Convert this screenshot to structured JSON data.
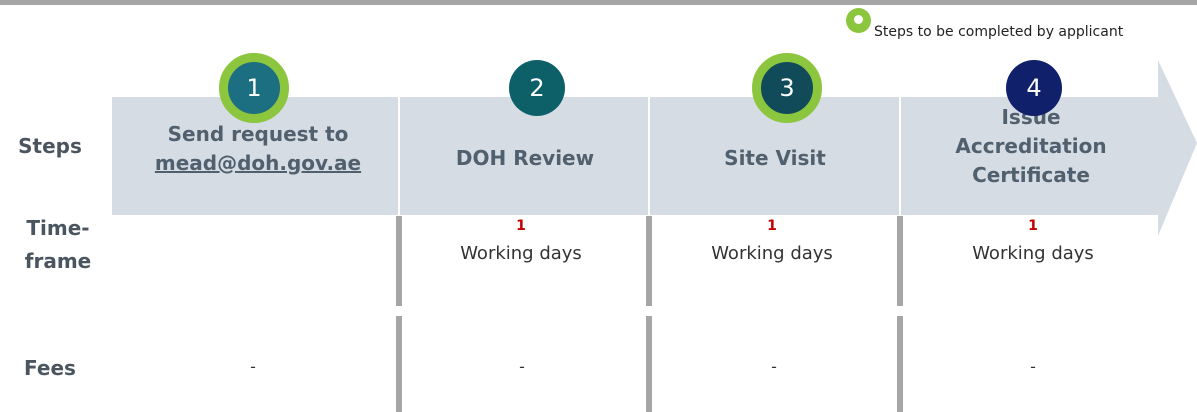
{
  "legend": {
    "text": "Steps to be completed by applicant",
    "applicant_color": "#8cc63f"
  },
  "row_labels": {
    "steps": "Steps",
    "timeframe": "Time-\nframe",
    "fees": "Fees"
  },
  "steps": [
    {
      "number": "1",
      "title_line1": "Send request to",
      "title_line2": "mead@doh.gov.ae",
      "completed_by_applicant": true,
      "badge_color": "#1b6f80"
    },
    {
      "number": "2",
      "title": "DOH Review",
      "completed_by_applicant": false,
      "badge_color": "#0e6068"
    },
    {
      "number": "3",
      "title": "Site Visit",
      "completed_by_applicant": true,
      "badge_color": "#114b5a"
    },
    {
      "number": "4",
      "title": "Issue\nAccreditation\nCertificate",
      "completed_by_applicant": false,
      "badge_color": "#10206b"
    }
  ],
  "timeframes": [
    {
      "value": "1",
      "unit": "Working days"
    },
    {
      "value": "1",
      "unit": "Working days"
    },
    {
      "value": "1",
      "unit": "Working days"
    }
  ],
  "fees": [
    "-",
    "-",
    "-",
    "-"
  ],
  "colors": {
    "arrow_fill": "#d6dce4",
    "divider": "#a6a6a6",
    "timeframe_value": "#c00000"
  }
}
